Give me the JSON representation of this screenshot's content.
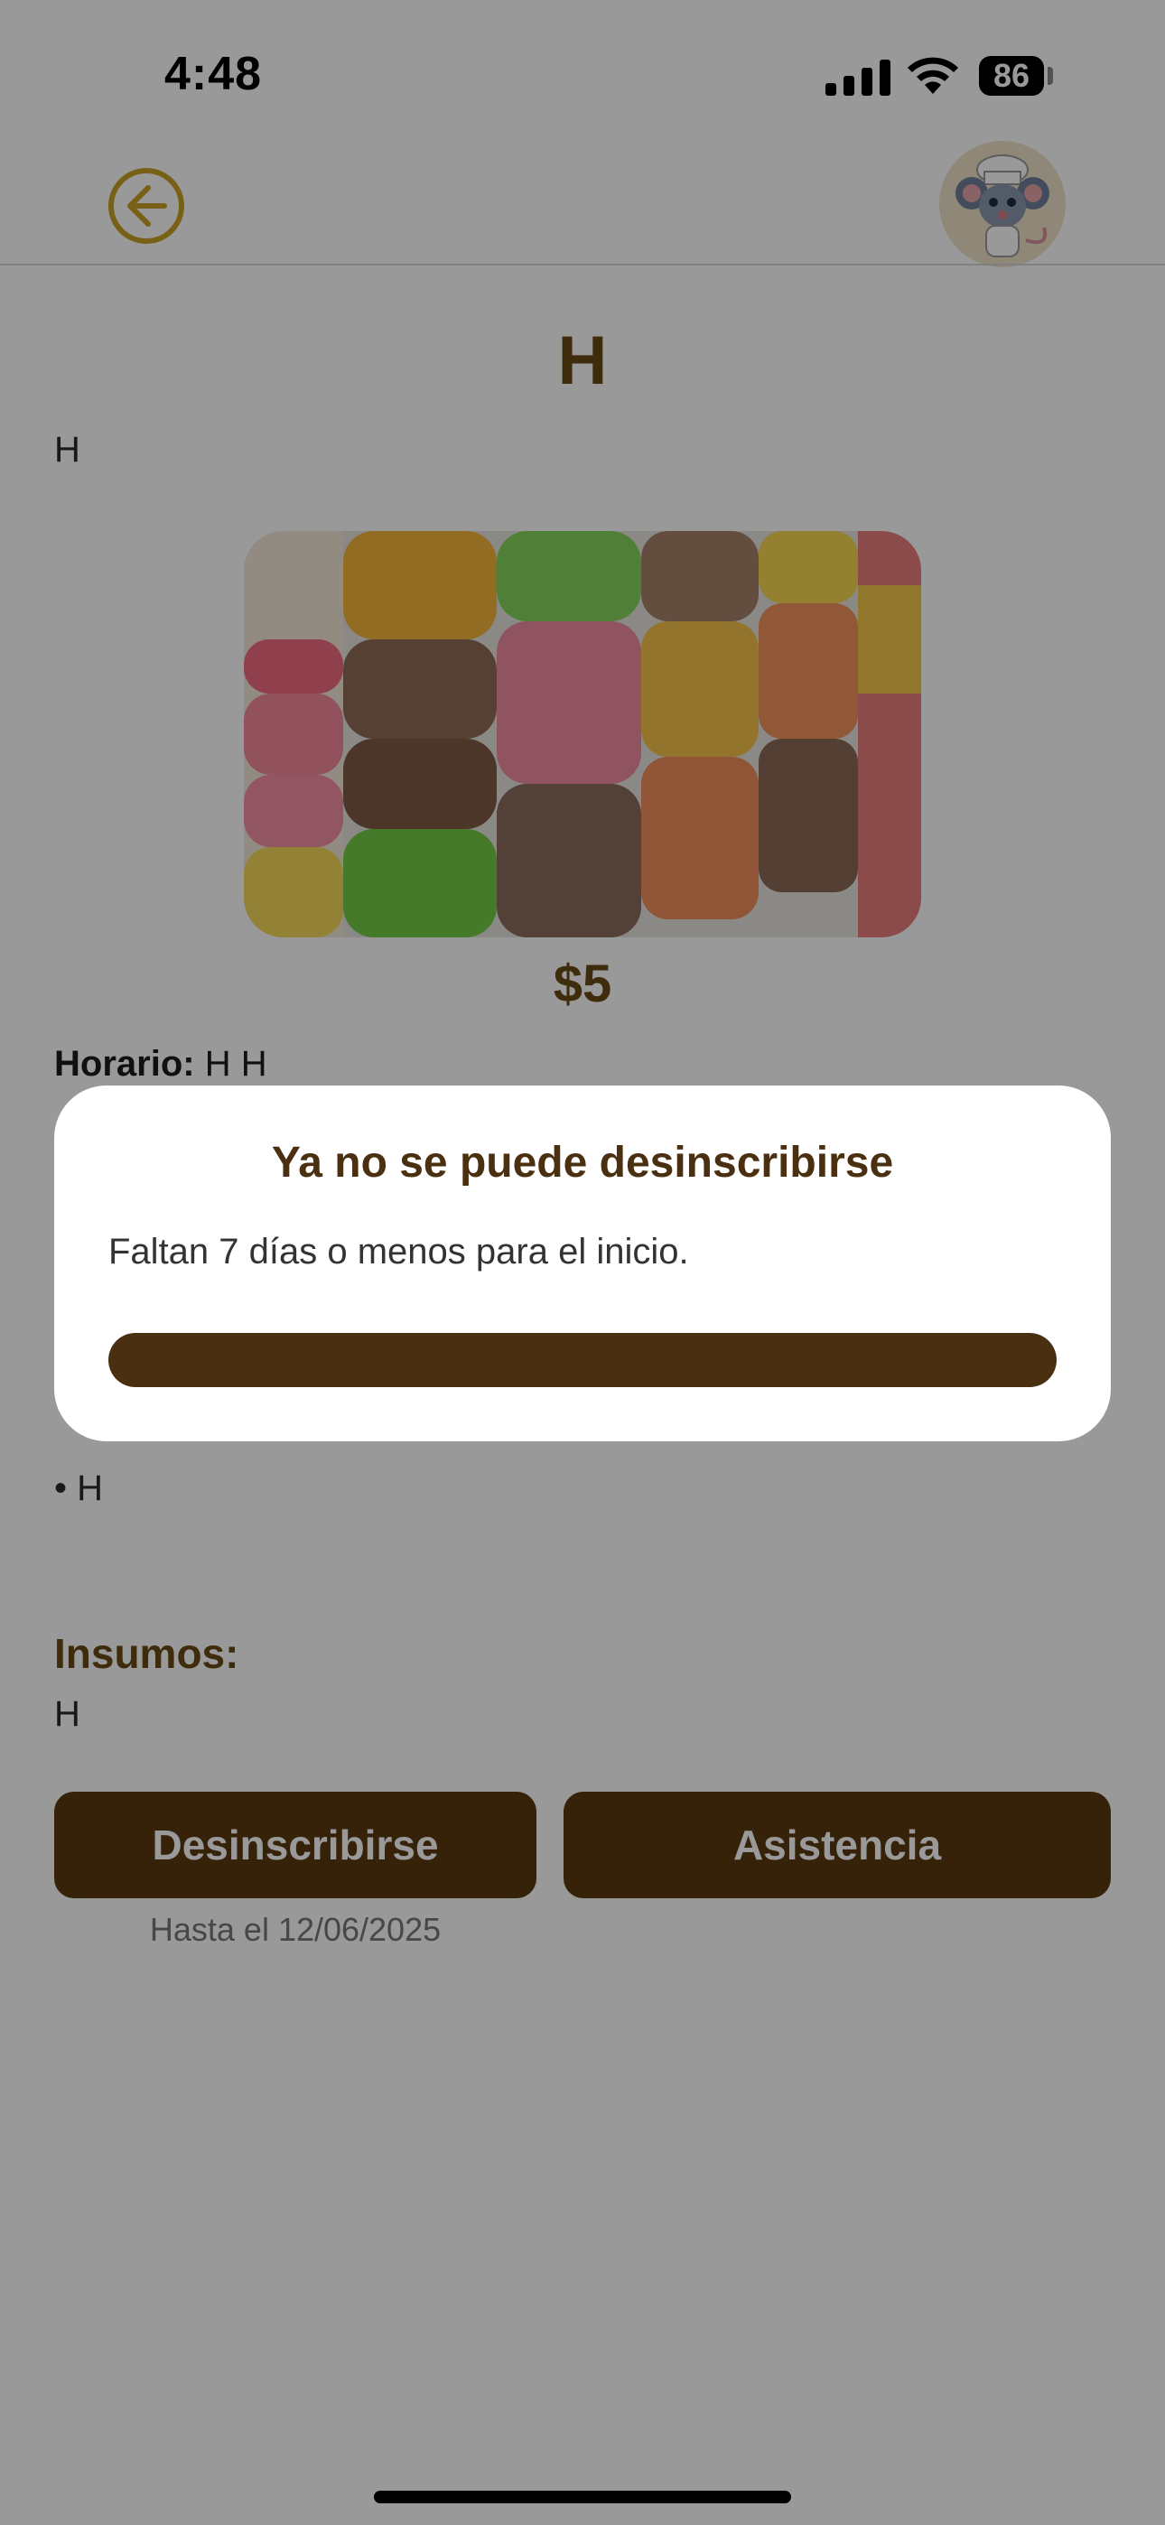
{
  "status_bar": {
    "time": "4:48",
    "battery": "86"
  },
  "header": {
    "back_icon": "arrow-left-circle-icon",
    "avatar_icon": "chef-mouse-avatar"
  },
  "course": {
    "title": "H",
    "description": "H",
    "image": "macarons-photo",
    "price": "$5",
    "schedule_label": "Horario:",
    "schedule_value": "H H",
    "utensils_bullet": "• H",
    "supplies_heading": "Insumos:",
    "supplies_value": "H"
  },
  "actions": {
    "unsubscribe_label": "Desinscribirse",
    "attendance_label": "Asistencia",
    "deadline_note": "Hasta el 12/06/2025"
  },
  "modal": {
    "title": "Ya no se puede desinscribirse",
    "message": "Faltan 7 días o menos para el inicio."
  },
  "colors": {
    "brand_brown": "#5a3a10",
    "heading_brown": "#6a4a14",
    "back_icon_gold": "#c9a227"
  }
}
